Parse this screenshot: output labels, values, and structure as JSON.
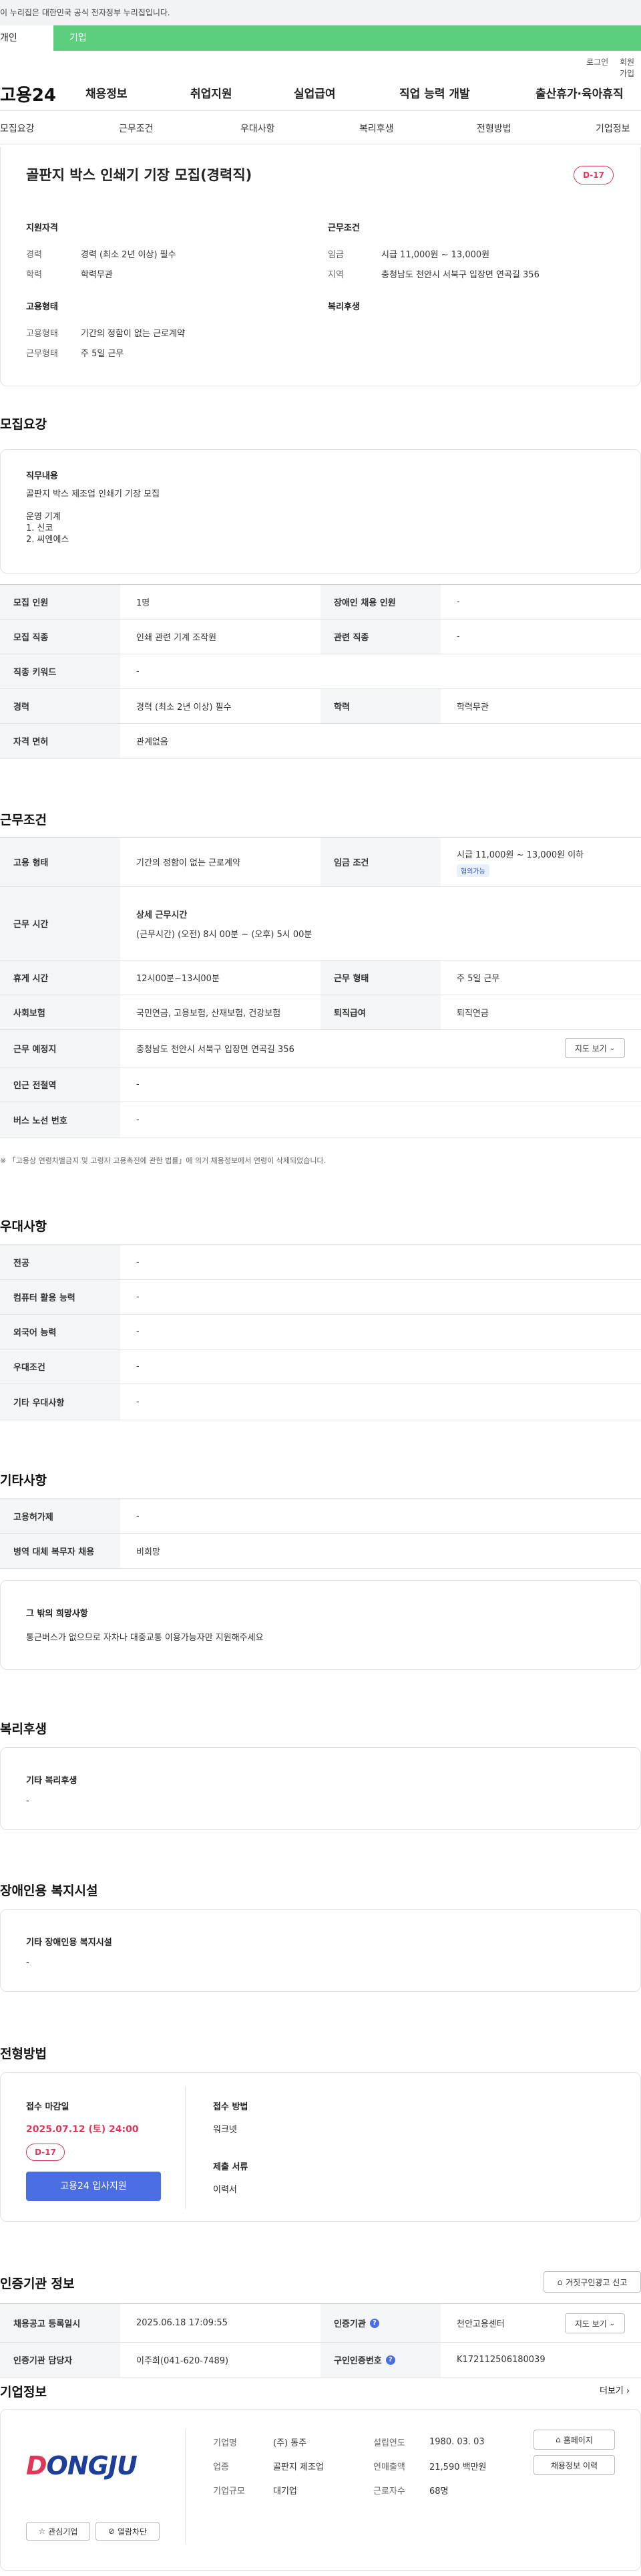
{
  "notice": "이 누리집은 대한민국 공식 전자정부 누리집입니다.",
  "user_tabs": {
    "personal": "개인",
    "company": "기업"
  },
  "top_links": {
    "login": "로그인",
    "join": "회원가입"
  },
  "gnb": {
    "logo": "고용24",
    "menu": [
      "채용정보",
      "취업지원",
      "실업급여",
      "직업 능력 개발",
      "출산휴가·육아휴직"
    ]
  },
  "subnav": [
    "모집요강",
    "근무조건",
    "우대사항",
    "복리후생",
    "전형방법",
    "기업정보"
  ],
  "summary": {
    "title": "골판지 박스 인쇄기 기장 모집(경력직)",
    "dday": "D-17",
    "qual_title": "지원자격",
    "qual": [
      {
        "k": "경력",
        "v": "경력 (최소 2년 이상) 필수"
      },
      {
        "k": "학력",
        "v": "학력무관"
      }
    ],
    "cond_title": "근무조건",
    "cond": [
      {
        "k": "임금",
        "v": "시급 11,000원 ~ 13,000원"
      },
      {
        "k": "지역",
        "v": "충청남도 천안시 서북구 입장면 연곡길 356"
      }
    ],
    "emp_title": "고용형태",
    "emp": [
      {
        "k": "고용형태",
        "v": "기간의 정함이 없는 근로계약"
      },
      {
        "k": "근무형태",
        "v": "주 5일 근무"
      }
    ],
    "welfare_title": "복리후생"
  },
  "recruit": {
    "title": "모집요강",
    "job_title": "직무내용",
    "job_lines": [
      "골판지 박스 제조업 인쇄기 기장 모집",
      "",
      "운영 기계",
      "1. 신코",
      "2. 씨엔에스"
    ],
    "rows": [
      {
        "k1": "모집 인원",
        "v1": "1명",
        "k2": "장애인 채용 인원",
        "v2": "-"
      },
      {
        "k1": "모집 직종",
        "v1": "인쇄 관련 기계 조작원",
        "k2": "관련 직종",
        "v2": "-"
      },
      {
        "k1": "직종 키워드",
        "v1": "-"
      },
      {
        "k1": "경력",
        "v1": "경력 (최소 2년 이상) 필수",
        "k2": "학력",
        "v2": "학력무관"
      },
      {
        "k1": "자격 면허",
        "v1": "관계없음"
      }
    ]
  },
  "work": {
    "title": "근무조건",
    "emp_type_k": "고용 형태",
    "emp_type_v": "기간의 정함이 없는 근로계약",
    "wage_k": "임금 조건",
    "wage_v": "시급 11,000원 ~ 13,000원 이하",
    "wage_badge": "협의가능",
    "hours_k": "근무 시간",
    "hours_title": "상세 근무시간",
    "hours_v": "(근무시간) (오전) 8시 00분 ~ (오후) 5시 00분",
    "rest_k": "휴게 시간",
    "rest_v": "12시00분~13시00분",
    "form_k": "근무 형태",
    "form_v": "주 5일 근무",
    "ins_k": "사회보험",
    "ins_v": "국민연금, 고용보험, 산재보험, 건강보험",
    "ret_k": "퇴직급여",
    "ret_v": "퇴직연금",
    "place_k": "근무 예정지",
    "place_v": "충청남도 천안시 서북구 입장면 연곡길 356",
    "map_btn": "지도 보기",
    "station_k": "인근 전철역",
    "station_v": "-",
    "bus_k": "버스 노선 번호",
    "bus_v": "-",
    "footnote": "※ 「고용상 연령차별금지 및 고령자 고용촉진에 관한 법률」에 의거 채용정보에서 연령이 삭제되었습니다."
  },
  "pref": {
    "title": "우대사항",
    "rows": [
      {
        "k": "전공",
        "v": "-"
      },
      {
        "k": "컴퓨터 활용 능력",
        "v": "-"
      },
      {
        "k": "외국어 능력",
        "v": "-"
      },
      {
        "k": "우대조건",
        "v": "-"
      },
      {
        "k": "기타 우대사항",
        "v": "-"
      }
    ]
  },
  "etc": {
    "title": "기타사항",
    "rows": [
      {
        "k": "고용허가제",
        "v": "-"
      },
      {
        "k": "병역 대체 복무자 채용",
        "v": "비희망"
      }
    ],
    "box_title": "그 밖의 희망사항",
    "box_text": "통근버스가 없으므로 자차나 대중교통 이용가능자만 지원해주세요"
  },
  "welfare": {
    "title": "복리후생",
    "box_title": "기타 복리후생",
    "box_text": "-"
  },
  "disabled": {
    "title": "장애인용 복지시설",
    "box_title": "기타 장애인용 복지시설",
    "box_text": "-"
  },
  "process": {
    "title": "전형방법",
    "deadline_k": "접수 마감일",
    "deadline_v": "2025.07.12 (토) 24:00",
    "dday": "D-17",
    "apply_btn": "고용24 입사지원",
    "method_k": "접수 방법",
    "method_v": "워크넷",
    "docs_k": "제출 서류",
    "docs_v": "이력서"
  },
  "cert": {
    "title": "인증기관 정보",
    "report_btn": "거짓구인광고 신고",
    "reg_k": "채용공고 등록일시",
    "reg_v": "2025.06.18 17:09:55",
    "agency_k": "인증기관",
    "agency_v": "천안고용센터",
    "map_btn": "지도 보기",
    "staff_k": "인증기관 담당자",
    "staff_v": "이주희(041-620-7489)",
    "no_k": "구인인증번호",
    "no_v": "K172112506180039"
  },
  "company": {
    "title": "기업정보",
    "more": "더보기",
    "logo_text": "DONGJU",
    "fav_btn": "관심기업",
    "block_btn": "열람차단",
    "info": [
      {
        "k1": "기업명",
        "v1": "(주) 동주",
        "k2": "설립연도",
        "v2": "1980. 03. 03"
      },
      {
        "k1": "업종",
        "v1": "골판지 제조업",
        "k2": "연매출액",
        "v2": "21,590 백만원"
      },
      {
        "k1": "기업규모",
        "v1": "대기업",
        "k2": "근로자수",
        "v2": "68명"
      }
    ],
    "homepage_btn": "홈페이지",
    "history_btn": "채용정보 이력"
  }
}
